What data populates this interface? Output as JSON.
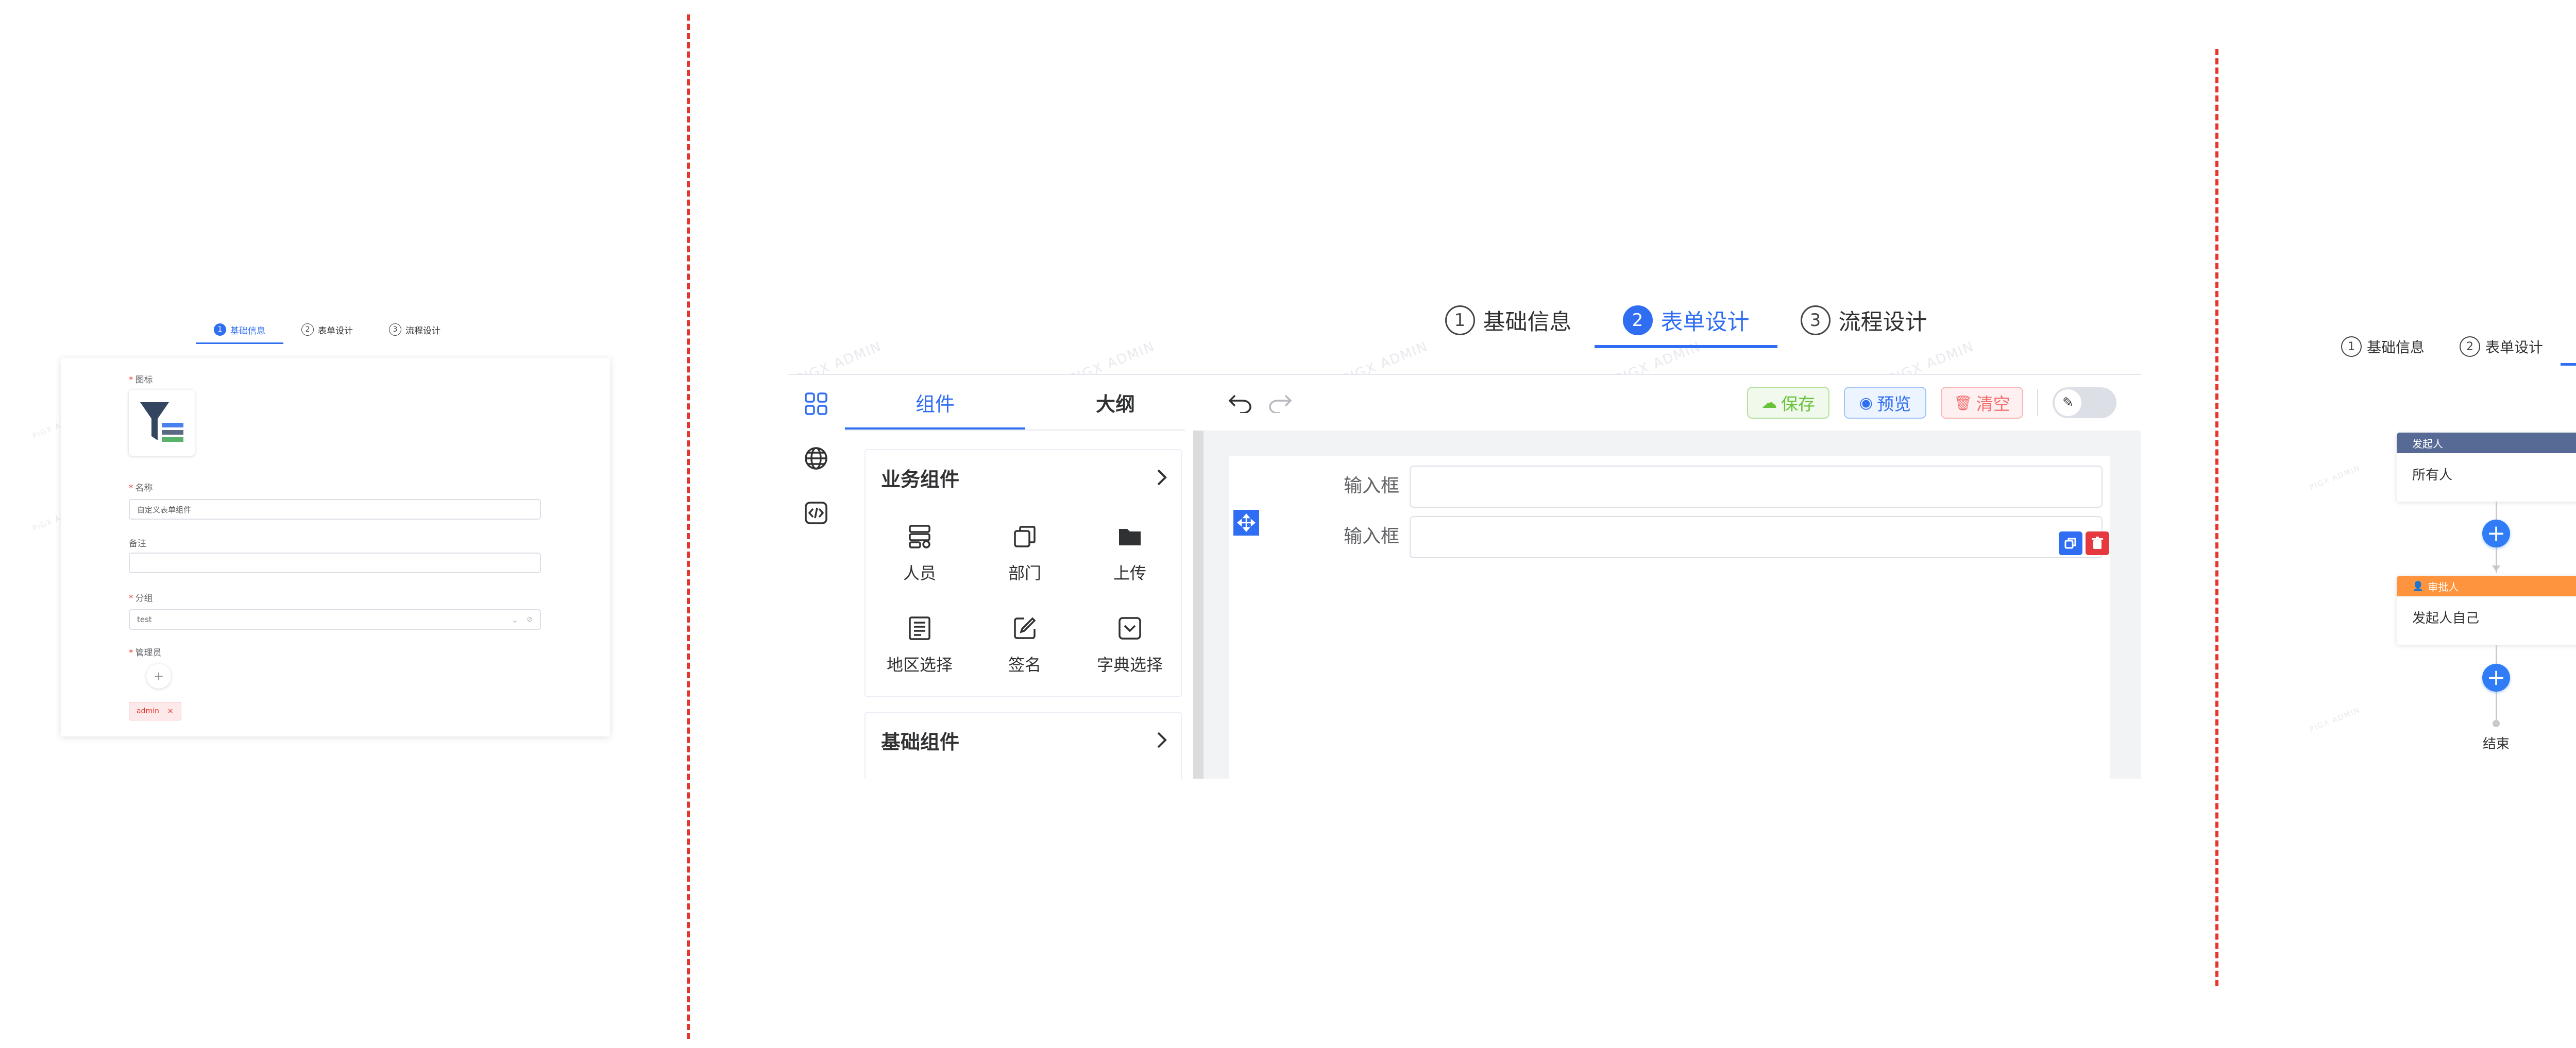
{
  "watermark": "PIGX ADMIN",
  "steps": [
    {
      "num": "1",
      "label": "基础信息"
    },
    {
      "num": "2",
      "label": "表单设计"
    },
    {
      "num": "3",
      "label": "流程设计"
    }
  ],
  "left": {
    "icon_label": "图标",
    "name_label": "名称",
    "name_value": "自定义表单组件",
    "remark_label": "备注",
    "remark_value": "",
    "group_label": "分组",
    "group_value": "test",
    "admin_label": "管理员",
    "add_symbol": "+",
    "admin_tag": "admin",
    "tag_close": "×"
  },
  "middle": {
    "tabs": [
      "组件",
      "大纲"
    ],
    "business_group": "业务组件",
    "basic_group": "基础组件",
    "chevron": "›",
    "components": [
      {
        "label": "人员",
        "icon": "user-group-icon"
      },
      {
        "label": "部门",
        "icon": "department-icon"
      },
      {
        "label": "上传",
        "icon": "folder-icon"
      },
      {
        "label": "地区选择",
        "icon": "region-icon"
      },
      {
        "label": "签名",
        "icon": "signature-icon"
      },
      {
        "label": "字典选择",
        "icon": "dictionary-icon"
      }
    ],
    "toolbar": {
      "save": "保存",
      "preview": "预览",
      "clear": "清空"
    },
    "fields": [
      {
        "label": "输入框",
        "value": ""
      },
      {
        "label": "输入框",
        "value": ""
      }
    ],
    "colors": {
      "accent": "#2f6ef2",
      "save": "#67c23a",
      "clear": "#f56c6c",
      "delete": "#e6393f"
    }
  },
  "right": {
    "initiator_title": "发起人",
    "initiator_value": "所有人",
    "approver_title": "审批人",
    "approver_value": "发起人自己",
    "end_label": "结束",
    "plus": "+",
    "chevron": "›",
    "colors": {
      "initiator": "#576a95",
      "approver": "#ff943e",
      "plus": "#2f7cf6"
    }
  }
}
